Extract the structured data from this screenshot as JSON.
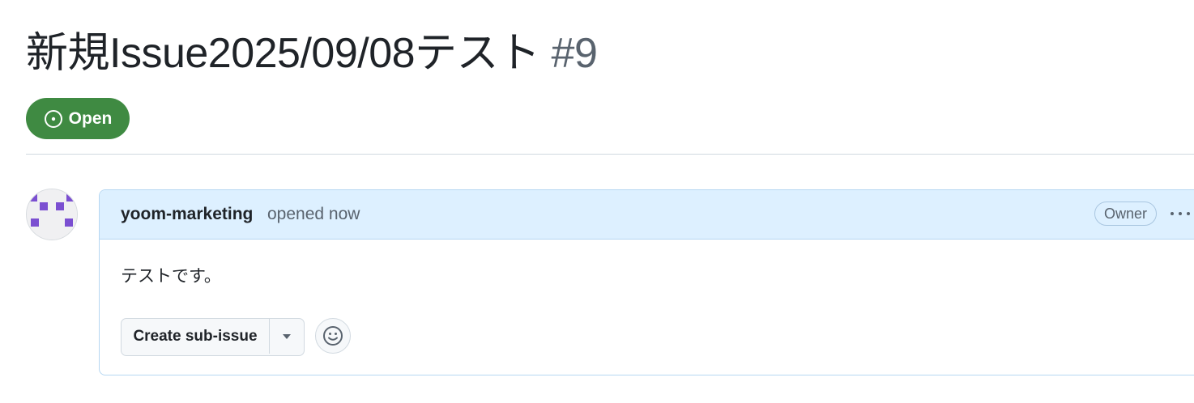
{
  "issue": {
    "title": "新規Issue2025/09/08テスト",
    "number": "#9",
    "state": {
      "label": "Open",
      "icon": "issue-opened-icon",
      "color": "#3f8a42"
    }
  },
  "comment": {
    "author": "yoom-marketing",
    "action": "opened now",
    "role_badge": "Owner",
    "body": "テストです。",
    "header_color": "#ddf0ff",
    "more_icon": "kebab-horizontal-icon"
  },
  "actions": {
    "create_sub_issue_label": "Create sub-issue",
    "dropdown_icon": "triangle-down-icon",
    "reaction_icon": "smiley-icon"
  },
  "avatar": {
    "icon": "identicon",
    "color": "#7b4fd1"
  }
}
